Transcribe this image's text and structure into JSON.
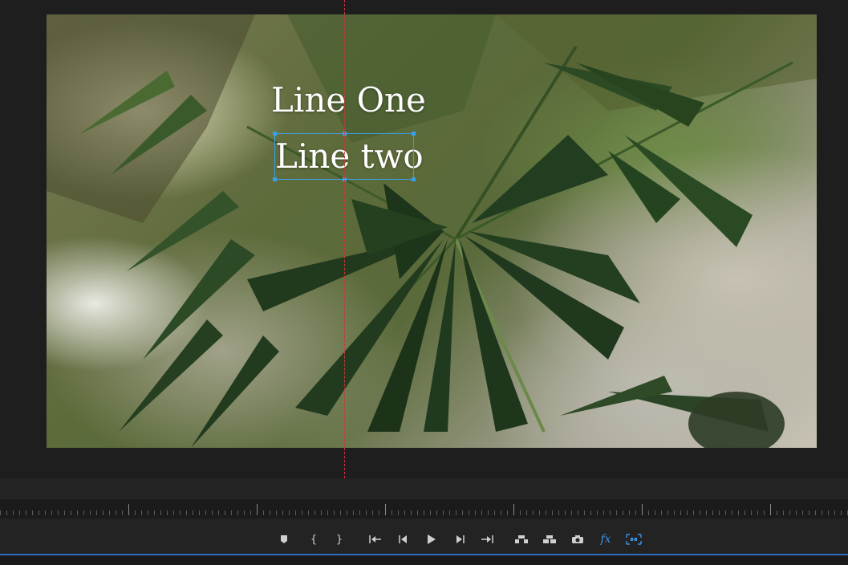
{
  "monitor": {
    "title_lines": [
      "Line One",
      "Line two"
    ],
    "selected_line_index": 1
  },
  "colors": {
    "guide": "#d23434",
    "selection": "#3aa0e8",
    "accent": "#3c8fe0",
    "panel": "#1e1e1e"
  },
  "transport": {
    "buttons": [
      {
        "name": "add-marker-button",
        "icon": "marker-icon"
      },
      {
        "name": "mark-in-button",
        "icon": "mark-in-icon",
        "glyph": "{"
      },
      {
        "name": "mark-out-button",
        "icon": "mark-out-icon",
        "glyph": "}"
      },
      {
        "name": "go-to-in-button",
        "icon": "go-to-in-icon"
      },
      {
        "name": "step-back-button",
        "icon": "step-back-icon"
      },
      {
        "name": "play-button",
        "icon": "play-icon"
      },
      {
        "name": "step-forward-button",
        "icon": "step-forward-icon"
      },
      {
        "name": "go-to-out-button",
        "icon": "go-to-out-icon"
      },
      {
        "name": "lift-button",
        "icon": "lift-icon"
      },
      {
        "name": "extract-button",
        "icon": "extract-icon"
      },
      {
        "name": "export-frame-button",
        "icon": "camera-icon"
      },
      {
        "name": "effects-button",
        "icon": "fx-icon",
        "glyph": "fx"
      },
      {
        "name": "comparison-view-button",
        "icon": "compare-icon"
      }
    ]
  }
}
